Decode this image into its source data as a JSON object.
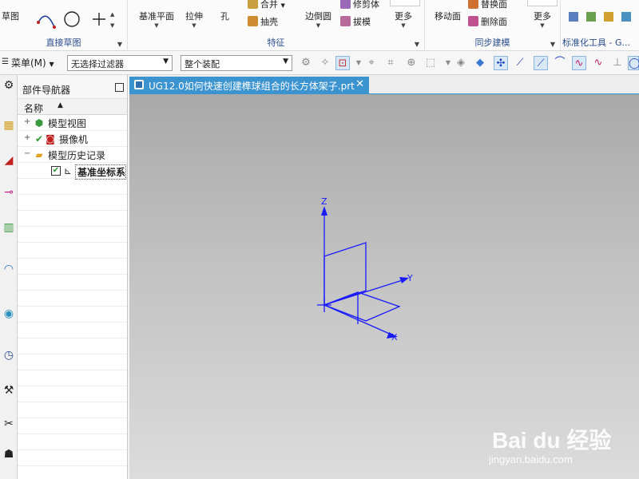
{
  "ribbon": {
    "groups": [
      {
        "label": "直接草图",
        "buttons": [
          "草图"
        ]
      },
      {
        "label": "特征",
        "buttons": [
          "基准平面",
          "拉伸",
          "孔",
          "合并",
          "抽壳",
          "边倒圆",
          "修剪体",
          "拔模",
          "更多"
        ]
      },
      {
        "label": "同步建模",
        "buttons": [
          "移动面",
          "替换面",
          "删除面",
          "更多"
        ]
      },
      {
        "label": "标准化工具 - G..."
      }
    ]
  },
  "toolbar": {
    "menu_label": "菜单(M)",
    "filter_value": "无选择过滤器",
    "assembly_value": "整个装配"
  },
  "navigator": {
    "title": "部件导航器",
    "column_name": "名称",
    "items": [
      {
        "label": "模型视图"
      },
      {
        "label": "摄像机"
      },
      {
        "label": "模型历史记录"
      },
      {
        "label": "基准坐标系"
      }
    ]
  },
  "document_tab": {
    "title": "UG12.0如何快速创建榫球组合的长方体架子.prt"
  },
  "axes": {
    "x": "X",
    "y": "Y",
    "z": "Z"
  },
  "watermark": {
    "main": "Bai du 经验",
    "sub": "jingyan.baidu.com"
  },
  "colors": {
    "accent": "#3b93cf",
    "csys": "#1a1aff",
    "label": "#2a4d8f"
  }
}
